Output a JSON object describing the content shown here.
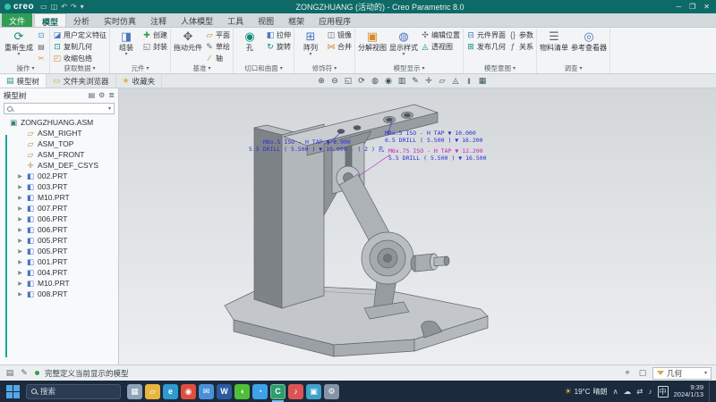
{
  "ui": {
    "caret": "▾"
  },
  "colors": {
    "titlebar": "#0d6a66",
    "file_tab_green": "#2f9e54",
    "accent_teal": "#19a79b",
    "note_blue": "#2b2fd4",
    "note_magenta": "#bf25bf",
    "taskbar_bg": "#1b2a3c"
  },
  "window": {
    "logo_text": "creo",
    "quick_access": [
      {
        "name": "new-file",
        "glyph": "▭"
      },
      {
        "name": "save",
        "glyph": "◫"
      },
      {
        "name": "undo",
        "glyph": "↶"
      },
      {
        "name": "redo",
        "glyph": "↷"
      },
      {
        "name": "more",
        "glyph": "▾"
      }
    ],
    "title": "ZONGZHUANG (活动的) - Creo Parametric 8.0",
    "controls": [
      {
        "name": "minimize",
        "glyph": "─"
      },
      {
        "name": "maximize",
        "glyph": "❐"
      },
      {
        "name": "close",
        "glyph": "✕"
      }
    ]
  },
  "tabs": {
    "items": [
      "文件",
      "模型",
      "分析",
      "实时仿真",
      "注释",
      "人体模型",
      "工具",
      "视图",
      "框架",
      "应用程序"
    ]
  },
  "ribbon": {
    "groups": [
      {
        "label": "操作",
        "buttons": [
          {
            "label": "重新生成",
            "glyph": "⟳"
          },
          {
            "label": "",
            "glyph": "⊡"
          },
          {
            "label": "",
            "glyph": "▤"
          },
          {
            "label": "",
            "glyph": "✂"
          }
        ]
      },
      {
        "label": "获取数据",
        "buttons": [
          {
            "label": "用户定义特征",
            "glyph": "◪"
          },
          {
            "label": "复制几何",
            "glyph": "⊡"
          },
          {
            "label": "收缩包络",
            "glyph": "◰"
          }
        ]
      },
      {
        "label": "元件",
        "buttons": [
          {
            "label": "组装",
            "glyph": "◨"
          },
          {
            "label": "创建",
            "glyph": "✚"
          },
          {
            "label": "封装",
            "glyph": "◱"
          }
        ]
      },
      {
        "label": "基准",
        "buttons": [
          {
            "label": "拖动元件",
            "glyph": "✥"
          },
          {
            "label": "平面",
            "glyph": "▱"
          },
          {
            "label": "草绘",
            "glyph": "✎"
          },
          {
            "label": "轴",
            "glyph": "∕"
          }
        ]
      },
      {
        "label": "切口和曲面",
        "buttons": [
          {
            "label": "孔",
            "glyph": "◉"
          },
          {
            "label": "拉伸",
            "glyph": "◧"
          },
          {
            "label": "旋转",
            "glyph": "↻"
          }
        ]
      },
      {
        "label": "修饰符",
        "buttons": [
          {
            "label": "阵列",
            "glyph": "⊞"
          },
          {
            "label": "镜像",
            "glyph": "◫"
          },
          {
            "label": "合并",
            "glyph": "⋈"
          }
        ]
      },
      {
        "label": "模型显示",
        "buttons": [
          {
            "label": "分解视图",
            "glyph": "▣"
          },
          {
            "label": "显示样式",
            "glyph": "◍"
          },
          {
            "label": "编辑位置",
            "glyph": "✣"
          },
          {
            "label": "透视图",
            "glyph": "◬"
          }
        ]
      },
      {
        "label": "模型意图",
        "buttons": [
          {
            "label": "元件界面",
            "glyph": "⊟"
          },
          {
            "label": "发布几何",
            "glyph": "⊞"
          },
          {
            "label": "参数",
            "glyph": "{}"
          },
          {
            "label": "关系",
            "glyph": "ƒ"
          }
        ]
      },
      {
        "label": "调查",
        "buttons": [
          {
            "label": "物料清单",
            "glyph": "☰"
          },
          {
            "label": "参考查看器",
            "glyph": "◎"
          }
        ]
      }
    ]
  },
  "panel_tabs": [
    {
      "label": "模型树",
      "glyph": "▤"
    },
    {
      "label": "文件夹浏览器",
      "glyph": "▭"
    },
    {
      "label": "收藏夹",
      "glyph": "★"
    }
  ],
  "graphics_toolbar": [
    {
      "name": "zoom-in",
      "glyph": "⊕"
    },
    {
      "name": "zoom-out",
      "glyph": "⊖"
    },
    {
      "name": "refit",
      "glyph": "◱"
    },
    {
      "name": "repaint",
      "glyph": "⟳"
    },
    {
      "name": "display-style",
      "glyph": "◍"
    },
    {
      "name": "saved-orientations",
      "glyph": "◉"
    },
    {
      "name": "view-manager",
      "glyph": "▥"
    },
    {
      "name": "annotation-display",
      "glyph": "✎"
    },
    {
      "name": "spin-center",
      "glyph": "✛"
    },
    {
      "name": "datum-display",
      "glyph": "▱"
    },
    {
      "name": "perspective-view",
      "glyph": "◬"
    },
    {
      "name": "pause",
      "glyph": "‖"
    },
    {
      "name": "collision-detection",
      "glyph": "▦"
    }
  ],
  "model_tree": {
    "header": "模型树",
    "header_icons": [
      {
        "name": "tree-filters",
        "glyph": "▤"
      },
      {
        "name": "tree-settings",
        "glyph": "⚙"
      },
      {
        "name": "tree-columns",
        "glyph": "≣"
      }
    ],
    "caret": "▶",
    "root": {
      "label": "ZONGZHUANG.ASM",
      "glyph": "▣"
    },
    "items": [
      {
        "label": "ASM_RIGHT",
        "glyph": "▱",
        "type": "datum-plane"
      },
      {
        "label": "ASM_TOP",
        "glyph": "▱",
        "type": "datum-plane"
      },
      {
        "label": "ASM_FRONT",
        "glyph": "▱",
        "type": "datum-plane"
      },
      {
        "label": "ASM_DEF_CSYS",
        "glyph": "✛",
        "type": "csys"
      },
      {
        "label": "002.PRT",
        "glyph": "◧",
        "type": "part"
      },
      {
        "label": "003.PRT",
        "glyph": "◧",
        "type": "part"
      },
      {
        "label": "M10.PRT",
        "glyph": "◧",
        "type": "part"
      },
      {
        "label": "007.PRT",
        "glyph": "◧",
        "type": "part"
      },
      {
        "label": "006.PRT",
        "glyph": "◧",
        "type": "part"
      },
      {
        "label": "006.PRT",
        "glyph": "◧",
        "type": "part"
      },
      {
        "label": "005.PRT",
        "glyph": "◧",
        "type": "part"
      },
      {
        "label": "005.PRT",
        "glyph": "◧",
        "type": "part"
      },
      {
        "label": "001.PRT",
        "glyph": "◧",
        "type": "part"
      },
      {
        "label": "004.PRT",
        "glyph": "◧",
        "type": "part"
      },
      {
        "label": "M10.PRT",
        "glyph": "◧",
        "type": "part"
      },
      {
        "label": "008.PRT",
        "glyph": "◧",
        "type": "part"
      }
    ]
  },
  "viewport": {
    "annotations": [
      {
        "line1": "M8x.5 ISO - H TAP ▼ 8.000",
        "line2": "5.5 DRILL ( 5.500 ) ▼ 10.000 - ( 2 ) 孔"
      },
      {
        "line1": "M8x.5 ISO - H TAP ▼ 10.000",
        "line2": "6.5 DRILL ( 5.500 ) ▼ 16.200"
      },
      {
        "line1": "M6x.75 ISO - H TAP ▼ 12.200",
        "line2": "5.5 DRILL ( 5.500 ) ▼ 16.500"
      }
    ]
  },
  "status_bar": {
    "left_icons": [
      {
        "name": "message-area",
        "glyph": "▤"
      },
      {
        "name": "notifications",
        "glyph": "✎"
      }
    ],
    "message": "完整定义当前显示的模型",
    "right_icons": [
      {
        "name": "pick-tool",
        "glyph": "⌖"
      },
      {
        "name": "box-select",
        "glyph": "▢"
      }
    ],
    "filter_label": "几何"
  },
  "taskbar": {
    "search_placeholder": "搜索",
    "icons": [
      {
        "name": "task-view",
        "glyph": "▦",
        "color": "#8fa3b8"
      },
      {
        "name": "file-explorer",
        "glyph": "▱",
        "color": "#e8b53e"
      },
      {
        "name": "edge-browser",
        "glyph": "e",
        "color": "#2e9ad0"
      },
      {
        "name": "chrome-browser",
        "glyph": "◉",
        "color": "#de4f3f"
      },
      {
        "name": "mail",
        "glyph": "✉",
        "color": "#4a90d9"
      },
      {
        "name": "word",
        "glyph": "W",
        "color": "#2b5aa0"
      },
      {
        "name": "wechat",
        "glyph": "◖",
        "color": "#4fbf3a"
      },
      {
        "name": "qq",
        "glyph": "◔",
        "color": "#3da2e8"
      },
      {
        "name": "creo-app",
        "glyph": "C",
        "color": "#2f9e6e"
      },
      {
        "name": "music-player",
        "glyph": "♪",
        "color": "#d95555"
      },
      {
        "name": "store",
        "glyph": "▣",
        "color": "#3fa2c9"
      },
      {
        "name": "settings",
        "glyph": "⚙",
        "color": "#8494a6"
      }
    ],
    "weather": {
      "icon": "☀",
      "temp": "19°C",
      "text": "晴朗"
    },
    "tray": [
      {
        "name": "hidden-icons",
        "glyph": "∧"
      },
      {
        "name": "onedrive",
        "glyph": "☁"
      },
      {
        "name": "network",
        "glyph": "⇄"
      },
      {
        "name": "volume",
        "glyph": "♪"
      },
      {
        "name": "ime-chinese",
        "glyph": "中"
      }
    ],
    "clock": {
      "time": "9:39",
      "date": "2024/1/13"
    }
  }
}
